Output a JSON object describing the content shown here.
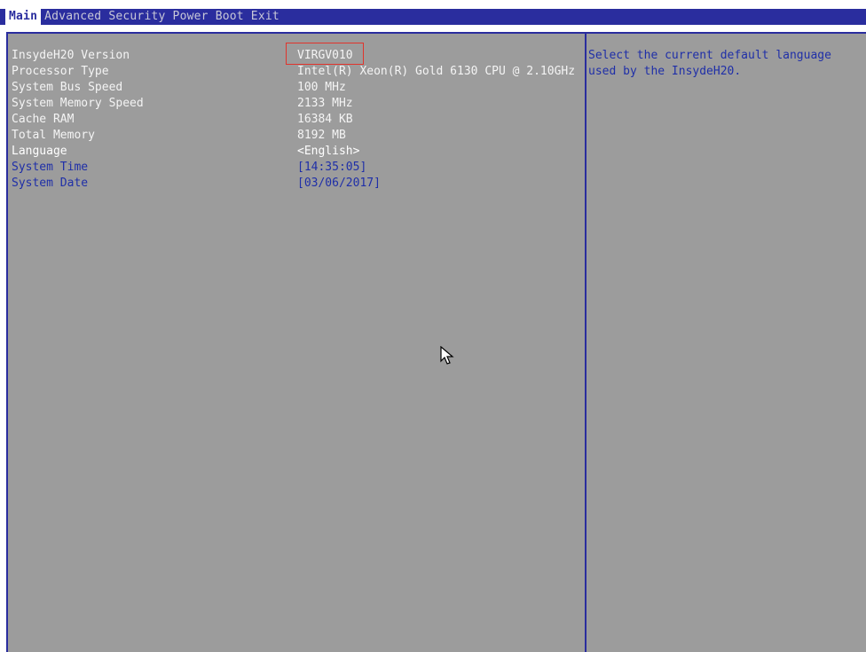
{
  "menubar": {
    "tabs": [
      {
        "label": "Main",
        "active": true
      },
      {
        "label": "Advanced",
        "active": false
      },
      {
        "label": "Security",
        "active": false
      },
      {
        "label": "Power",
        "active": false
      },
      {
        "label": "Boot",
        "active": false
      },
      {
        "label": "Exit",
        "active": false
      }
    ]
  },
  "main": {
    "rows": [
      {
        "label": "InsydeH20 Version",
        "value": "VIRGV010"
      },
      {
        "label": "Processor Type",
        "value": "Intel(R) Xeon(R) Gold 6130 CPU @ 2.10GHz"
      },
      {
        "label": "System Bus Speed",
        "value": "100 MHz"
      },
      {
        "label": "System Memory Speed",
        "value": "2133 MHz"
      },
      {
        "label": "Cache RAM",
        "value": "16384 KB"
      },
      {
        "label": "Total Memory",
        "value": "8192 MB"
      },
      {
        "label": "Language",
        "value": "<English>"
      },
      {
        "label": "System Time",
        "value": "[14:35:05]"
      },
      {
        "label": "System Date",
        "value": "[03/06/2017]"
      }
    ]
  },
  "help": {
    "text": "Select the current default language used by the InsydeH20."
  },
  "colors": {
    "menubar_bg": "#2a2d9e",
    "panel_bg": "#9c9c9c",
    "link_text": "#1f2fa8",
    "highlight_box": "#e0342c"
  },
  "icons": {
    "pointer": "mouse-pointer-icon"
  }
}
